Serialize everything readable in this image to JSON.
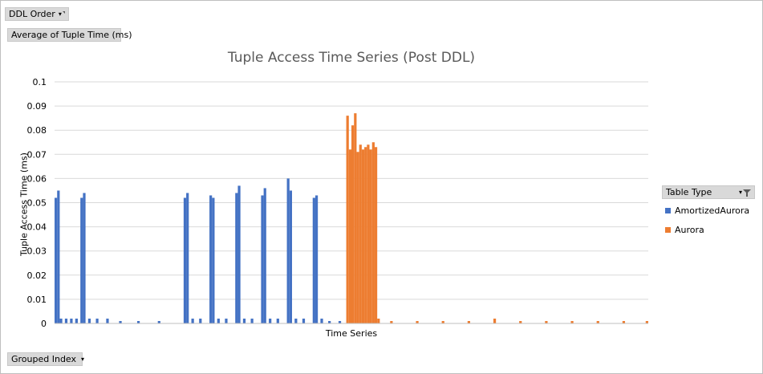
{
  "filters": {
    "ddl_order": "DDL Order",
    "value_field": "Average of Tuple Time  (ms)",
    "axis_field": "Grouped Index",
    "legend_field": "Table Type"
  },
  "chart_data": {
    "type": "bar",
    "title": "Tuple Access Time Series (Post DDL)",
    "xlabel": "Time Series",
    "ylabel": "Tuple Access Time (ms)",
    "ylim": [
      0,
      0.1
    ],
    "yticks": [
      {
        "v": 0,
        "label": "0"
      },
      {
        "v": 0.01,
        "label": "0.01"
      },
      {
        "v": 0.02,
        "label": "0.02"
      },
      {
        "v": 0.03,
        "label": "0.03"
      },
      {
        "v": 0.04,
        "label": "0.04"
      },
      {
        "v": 0.05,
        "label": "0.05"
      },
      {
        "v": 0.06,
        "label": "0.06"
      },
      {
        "v": 0.07,
        "label": "0.07"
      },
      {
        "v": 0.08,
        "label": "0.08"
      },
      {
        "v": 0.09,
        "label": "0.09"
      },
      {
        "v": 0.1,
        "label": "0.1"
      }
    ],
    "grid": true,
    "legend_position": "right",
    "series": [
      {
        "name": "AmortizedAurora",
        "color": "#4472c4",
        "bars": [
          {
            "x": 0,
            "y": 0.052
          },
          {
            "x": 1,
            "y": 0.055
          },
          {
            "x": 2,
            "y": 0.002
          },
          {
            "x": 4,
            "y": 0.002
          },
          {
            "x": 6,
            "y": 0.002
          },
          {
            "x": 8,
            "y": 0.002
          },
          {
            "x": 10,
            "y": 0.052
          },
          {
            "x": 11,
            "y": 0.054
          },
          {
            "x": 13,
            "y": 0.002
          },
          {
            "x": 16,
            "y": 0.002
          },
          {
            "x": 20,
            "y": 0.002
          },
          {
            "x": 25,
            "y": 0.001
          },
          {
            "x": 32,
            "y": 0.001
          },
          {
            "x": 40,
            "y": 0.001
          },
          {
            "x": 50,
            "y": 0.052
          },
          {
            "x": 51,
            "y": 0.054
          },
          {
            "x": 53,
            "y": 0.002
          },
          {
            "x": 56,
            "y": 0.002
          },
          {
            "x": 60,
            "y": 0.053
          },
          {
            "x": 61,
            "y": 0.052
          },
          {
            "x": 63,
            "y": 0.002
          },
          {
            "x": 66,
            "y": 0.002
          },
          {
            "x": 70,
            "y": 0.054
          },
          {
            "x": 71,
            "y": 0.057
          },
          {
            "x": 73,
            "y": 0.002
          },
          {
            "x": 76,
            "y": 0.002
          },
          {
            "x": 80,
            "y": 0.053
          },
          {
            "x": 81,
            "y": 0.056
          },
          {
            "x": 83,
            "y": 0.002
          },
          {
            "x": 86,
            "y": 0.002
          },
          {
            "x": 90,
            "y": 0.06
          },
          {
            "x": 91,
            "y": 0.055
          },
          {
            "x": 93,
            "y": 0.002
          },
          {
            "x": 96,
            "y": 0.002
          },
          {
            "x": 100,
            "y": 0.052
          },
          {
            "x": 101,
            "y": 0.053
          },
          {
            "x": 103,
            "y": 0.002
          },
          {
            "x": 106,
            "y": 0.001
          },
          {
            "x": 110,
            "y": 0.001
          }
        ]
      },
      {
        "name": "Aurora",
        "color": "#ed7d31",
        "bars": [
          {
            "x": 113,
            "y": 0.086
          },
          {
            "x": 114,
            "y": 0.072
          },
          {
            "x": 115,
            "y": 0.082
          },
          {
            "x": 116,
            "y": 0.087
          },
          {
            "x": 117,
            "y": 0.071
          },
          {
            "x": 118,
            "y": 0.074
          },
          {
            "x": 119,
            "y": 0.072
          },
          {
            "x": 120,
            "y": 0.073
          },
          {
            "x": 121,
            "y": 0.074
          },
          {
            "x": 122,
            "y": 0.072
          },
          {
            "x": 123,
            "y": 0.075
          },
          {
            "x": 124,
            "y": 0.073
          },
          {
            "x": 125,
            "y": 0.002
          },
          {
            "x": 130,
            "y": 0.001
          },
          {
            "x": 140,
            "y": 0.001
          },
          {
            "x": 150,
            "y": 0.001
          },
          {
            "x": 160,
            "y": 0.001
          },
          {
            "x": 170,
            "y": 0.002
          },
          {
            "x": 180,
            "y": 0.001
          },
          {
            "x": 190,
            "y": 0.001
          },
          {
            "x": 200,
            "y": 0.001
          },
          {
            "x": 210,
            "y": 0.001
          },
          {
            "x": 220,
            "y": 0.001
          },
          {
            "x": 229,
            "y": 0.001
          }
        ]
      }
    ]
  }
}
